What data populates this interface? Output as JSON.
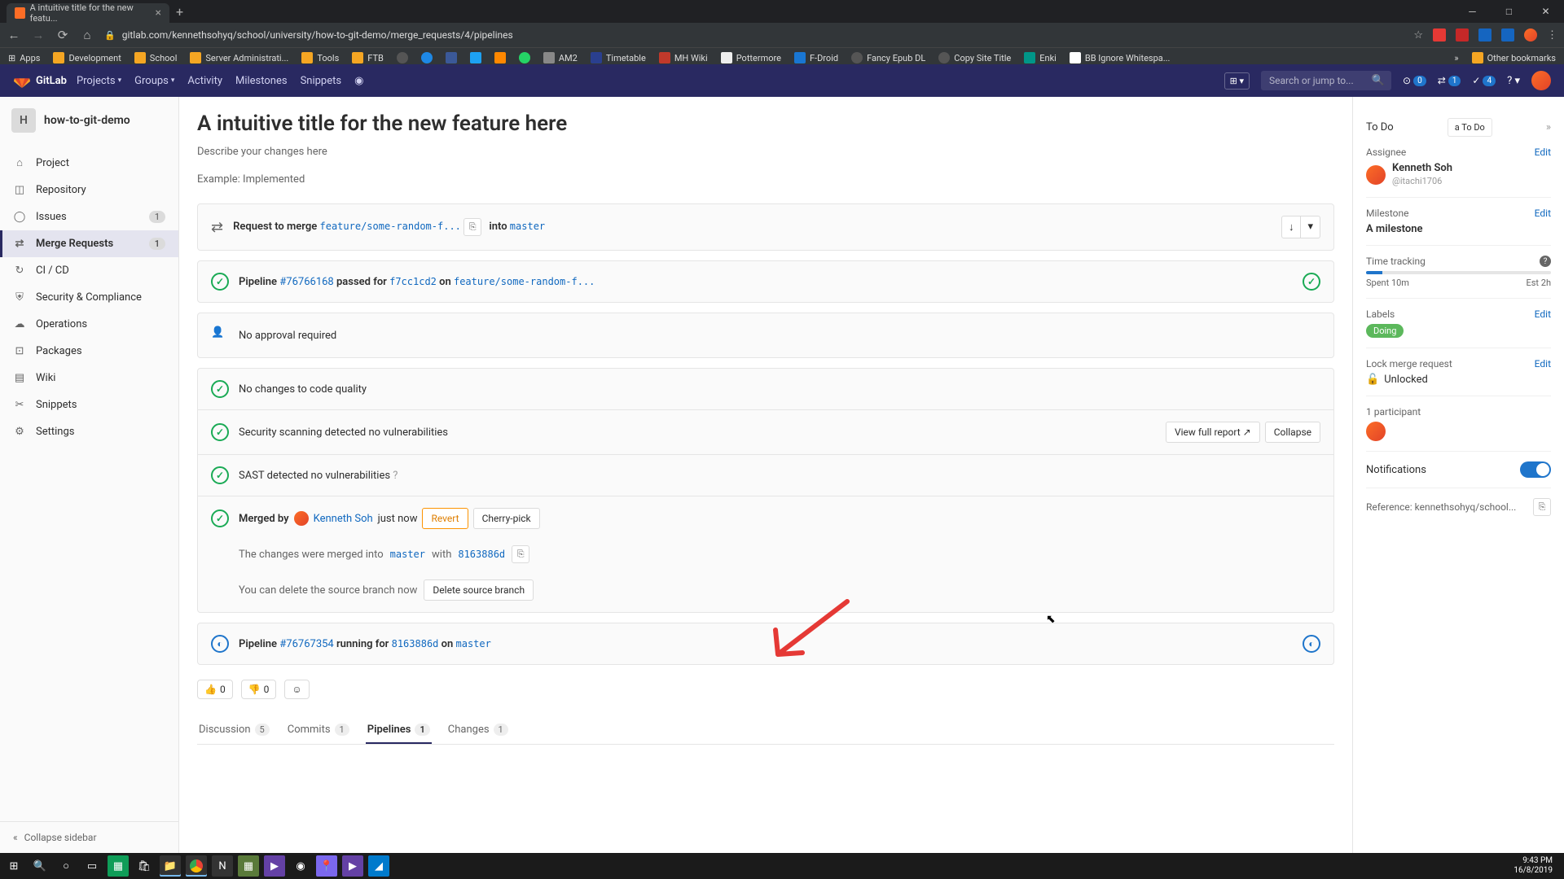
{
  "browser": {
    "tab_title": "A intuitive title for the new featu...",
    "url": "gitlab.com/kennethsohyq/school/university/how-to-git-demo/merge_requests/4/pipelines",
    "bookmarks": [
      "Apps",
      "Development",
      "School",
      "Server Administrati...",
      "Tools",
      "FTB",
      "",
      "",
      "",
      "",
      "",
      "AM2",
      "Timetable",
      "MH Wiki",
      "Pottermore",
      "F-Droid",
      "Fancy Epub DL",
      "Copy Site Title",
      "Enki",
      "BB Ignore Whitespa..."
    ],
    "other_bookmarks": "Other bookmarks"
  },
  "header": {
    "brand": "GitLab",
    "nav": [
      "Projects",
      "Groups",
      "Activity",
      "Milestones",
      "Snippets"
    ],
    "search_placeholder": "Search or jump to...",
    "issues_count": "0",
    "mr_count": "1",
    "todo_count": "4"
  },
  "sidebar": {
    "project_initial": "H",
    "project_name": "how-to-git-demo",
    "items": [
      {
        "icon": "home",
        "label": "Project"
      },
      {
        "icon": "repo",
        "label": "Repository"
      },
      {
        "icon": "issues",
        "label": "Issues",
        "badge": "1"
      },
      {
        "icon": "mr",
        "label": "Merge Requests",
        "badge": "1",
        "active": true
      },
      {
        "icon": "ci",
        "label": "CI / CD"
      },
      {
        "icon": "shield",
        "label": "Security & Compliance"
      },
      {
        "icon": "ops",
        "label": "Operations"
      },
      {
        "icon": "pkg",
        "label": "Packages"
      },
      {
        "icon": "wiki",
        "label": "Wiki"
      },
      {
        "icon": "snip",
        "label": "Snippets"
      },
      {
        "icon": "gear",
        "label": "Settings"
      }
    ],
    "collapse": "Collapse sidebar"
  },
  "mr": {
    "title": "A intuitive title for the new feature here",
    "desc1": "Describe your changes here",
    "desc2": "Example: Implemented",
    "request_merge_label": "Request to merge",
    "source_branch": "feature/some-random-f...",
    "into_label": "into",
    "target_branch": "master",
    "pipeline1": {
      "label": "Pipeline",
      "id": "#76766168",
      "status": "passed for",
      "sha": "f7cc1cd2",
      "on": "on",
      "branch": "feature/some-random-f..."
    },
    "approval": "No approval required",
    "code_quality": "No changes to code quality",
    "security": "Security scanning detected no vulnerabilities",
    "view_report": "View full report",
    "collapse": "Collapse",
    "sast": "SAST detected no vulnerabilities",
    "merged_by": "Merged by",
    "merged_user": "Kenneth Soh",
    "merged_time": "just now",
    "revert": "Revert",
    "cherry_pick": "Cherry-pick",
    "merged_into_text": "The changes were merged into",
    "merged_branch": "master",
    "with_label": "with",
    "merge_sha": "8163886d",
    "delete_text": "You can delete the source branch now",
    "delete_btn": "Delete source branch",
    "pipeline2": {
      "label": "Pipeline",
      "id": "#76767354",
      "status": "running for",
      "sha": "8163886d",
      "on": "on",
      "branch": "master"
    },
    "thumbs_up": "0",
    "thumbs_down": "0",
    "tabs": [
      {
        "label": "Discussion",
        "count": "5"
      },
      {
        "label": "Commits",
        "count": "1"
      },
      {
        "label": "Pipelines",
        "count": "1",
        "active": true
      },
      {
        "label": "Changes",
        "count": "1"
      }
    ]
  },
  "right": {
    "todo": "To Do",
    "add_todo": "a To Do",
    "assignee_label": "Assignee",
    "edit": "Edit",
    "assignee_name": "Kenneth Soh",
    "assignee_handle": "@itachi1706",
    "milestone_label": "Milestone",
    "milestone_value": "A milestone",
    "time_label": "Time tracking",
    "spent": "Spent 10m",
    "est": "Est 2h",
    "labels_label": "Labels",
    "label_chip": "Doing",
    "lock_label": "Lock merge request",
    "lock_value": "Unlocked",
    "participants": "1 participant",
    "notifications": "Notifications",
    "reference_label": "Reference:",
    "reference": "kennethsohyq/school..."
  },
  "taskbar": {
    "time": "9:43 PM",
    "date": "16/8/2019"
  }
}
